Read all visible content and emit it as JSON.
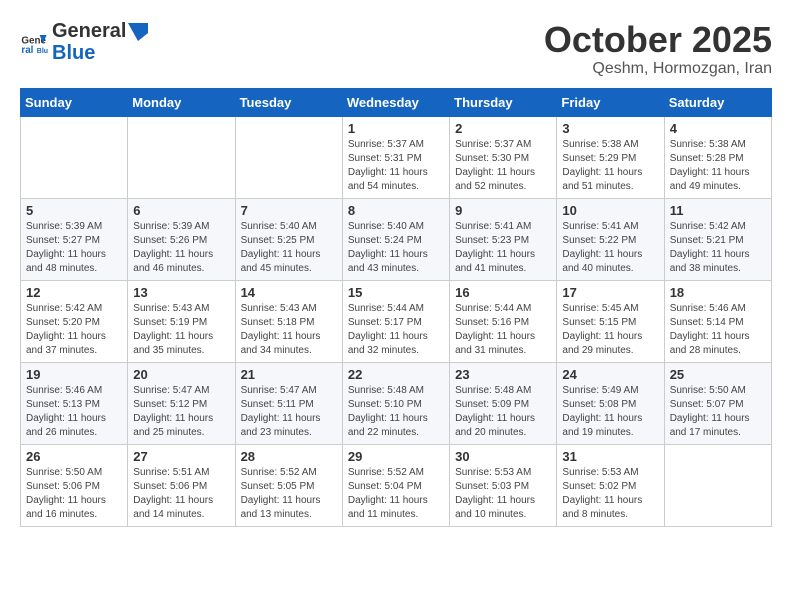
{
  "header": {
    "logo_general": "General",
    "logo_blue": "Blue",
    "month": "October 2025",
    "location": "Qeshm, Hormozgan, Iran"
  },
  "weekdays": [
    "Sunday",
    "Monday",
    "Tuesday",
    "Wednesday",
    "Thursday",
    "Friday",
    "Saturday"
  ],
  "weeks": [
    [
      {
        "day": "",
        "info": ""
      },
      {
        "day": "",
        "info": ""
      },
      {
        "day": "",
        "info": ""
      },
      {
        "day": "1",
        "info": "Sunrise: 5:37 AM\nSunset: 5:31 PM\nDaylight: 11 hours\nand 54 minutes."
      },
      {
        "day": "2",
        "info": "Sunrise: 5:37 AM\nSunset: 5:30 PM\nDaylight: 11 hours\nand 52 minutes."
      },
      {
        "day": "3",
        "info": "Sunrise: 5:38 AM\nSunset: 5:29 PM\nDaylight: 11 hours\nand 51 minutes."
      },
      {
        "day": "4",
        "info": "Sunrise: 5:38 AM\nSunset: 5:28 PM\nDaylight: 11 hours\nand 49 minutes."
      }
    ],
    [
      {
        "day": "5",
        "info": "Sunrise: 5:39 AM\nSunset: 5:27 PM\nDaylight: 11 hours\nand 48 minutes."
      },
      {
        "day": "6",
        "info": "Sunrise: 5:39 AM\nSunset: 5:26 PM\nDaylight: 11 hours\nand 46 minutes."
      },
      {
        "day": "7",
        "info": "Sunrise: 5:40 AM\nSunset: 5:25 PM\nDaylight: 11 hours\nand 45 minutes."
      },
      {
        "day": "8",
        "info": "Sunrise: 5:40 AM\nSunset: 5:24 PM\nDaylight: 11 hours\nand 43 minutes."
      },
      {
        "day": "9",
        "info": "Sunrise: 5:41 AM\nSunset: 5:23 PM\nDaylight: 11 hours\nand 41 minutes."
      },
      {
        "day": "10",
        "info": "Sunrise: 5:41 AM\nSunset: 5:22 PM\nDaylight: 11 hours\nand 40 minutes."
      },
      {
        "day": "11",
        "info": "Sunrise: 5:42 AM\nSunset: 5:21 PM\nDaylight: 11 hours\nand 38 minutes."
      }
    ],
    [
      {
        "day": "12",
        "info": "Sunrise: 5:42 AM\nSunset: 5:20 PM\nDaylight: 11 hours\nand 37 minutes."
      },
      {
        "day": "13",
        "info": "Sunrise: 5:43 AM\nSunset: 5:19 PM\nDaylight: 11 hours\nand 35 minutes."
      },
      {
        "day": "14",
        "info": "Sunrise: 5:43 AM\nSunset: 5:18 PM\nDaylight: 11 hours\nand 34 minutes."
      },
      {
        "day": "15",
        "info": "Sunrise: 5:44 AM\nSunset: 5:17 PM\nDaylight: 11 hours\nand 32 minutes."
      },
      {
        "day": "16",
        "info": "Sunrise: 5:44 AM\nSunset: 5:16 PM\nDaylight: 11 hours\nand 31 minutes."
      },
      {
        "day": "17",
        "info": "Sunrise: 5:45 AM\nSunset: 5:15 PM\nDaylight: 11 hours\nand 29 minutes."
      },
      {
        "day": "18",
        "info": "Sunrise: 5:46 AM\nSunset: 5:14 PM\nDaylight: 11 hours\nand 28 minutes."
      }
    ],
    [
      {
        "day": "19",
        "info": "Sunrise: 5:46 AM\nSunset: 5:13 PM\nDaylight: 11 hours\nand 26 minutes."
      },
      {
        "day": "20",
        "info": "Sunrise: 5:47 AM\nSunset: 5:12 PM\nDaylight: 11 hours\nand 25 minutes."
      },
      {
        "day": "21",
        "info": "Sunrise: 5:47 AM\nSunset: 5:11 PM\nDaylight: 11 hours\nand 23 minutes."
      },
      {
        "day": "22",
        "info": "Sunrise: 5:48 AM\nSunset: 5:10 PM\nDaylight: 11 hours\nand 22 minutes."
      },
      {
        "day": "23",
        "info": "Sunrise: 5:48 AM\nSunset: 5:09 PM\nDaylight: 11 hours\nand 20 minutes."
      },
      {
        "day": "24",
        "info": "Sunrise: 5:49 AM\nSunset: 5:08 PM\nDaylight: 11 hours\nand 19 minutes."
      },
      {
        "day": "25",
        "info": "Sunrise: 5:50 AM\nSunset: 5:07 PM\nDaylight: 11 hours\nand 17 minutes."
      }
    ],
    [
      {
        "day": "26",
        "info": "Sunrise: 5:50 AM\nSunset: 5:06 PM\nDaylight: 11 hours\nand 16 minutes."
      },
      {
        "day": "27",
        "info": "Sunrise: 5:51 AM\nSunset: 5:06 PM\nDaylight: 11 hours\nand 14 minutes."
      },
      {
        "day": "28",
        "info": "Sunrise: 5:52 AM\nSunset: 5:05 PM\nDaylight: 11 hours\nand 13 minutes."
      },
      {
        "day": "29",
        "info": "Sunrise: 5:52 AM\nSunset: 5:04 PM\nDaylight: 11 hours\nand 11 minutes."
      },
      {
        "day": "30",
        "info": "Sunrise: 5:53 AM\nSunset: 5:03 PM\nDaylight: 11 hours\nand 10 minutes."
      },
      {
        "day": "31",
        "info": "Sunrise: 5:53 AM\nSunset: 5:02 PM\nDaylight: 11 hours\nand 8 minutes."
      },
      {
        "day": "",
        "info": ""
      }
    ]
  ]
}
